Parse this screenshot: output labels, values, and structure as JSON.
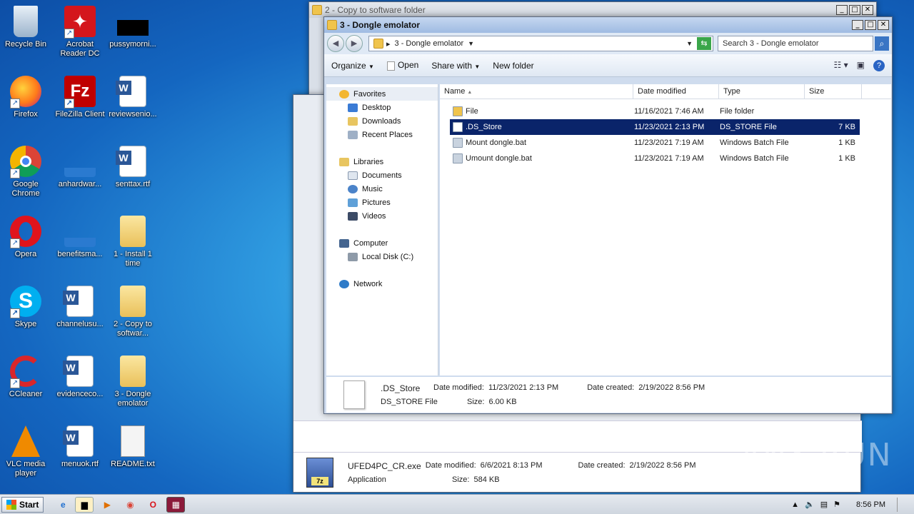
{
  "desktop": {
    "icons": [
      {
        "label": "Recycle Bin"
      },
      {
        "label": "Acrobat Reader DC"
      },
      {
        "label": "pussymorni..."
      },
      {
        "label": "Firefox"
      },
      {
        "label": "FileZilla Client"
      },
      {
        "label": "reviewsenio..."
      },
      {
        "label": "Google Chrome"
      },
      {
        "label": "anhardwar..."
      },
      {
        "label": "senttax.rtf"
      },
      {
        "label": "Opera"
      },
      {
        "label": "benefitsma..."
      },
      {
        "label": "1 - Install 1 time"
      },
      {
        "label": "Skype"
      },
      {
        "label": "channelusu..."
      },
      {
        "label": "2 - Copy to softwar..."
      },
      {
        "label": "CCleaner"
      },
      {
        "label": "evidenceco..."
      },
      {
        "label": "3 - Dongle emolator"
      },
      {
        "label": "VLC media player"
      },
      {
        "label": "menuok.rtf"
      },
      {
        "label": "README.txt"
      }
    ]
  },
  "back_window": {
    "title": "2 - Copy to software folder",
    "details": {
      "name": "UFED4PC_CR.exe",
      "type": "Application",
      "date_modified_label": "Date modified:",
      "date_modified": "6/6/2021 8:13 PM",
      "size_label": "Size:",
      "size": "584 KB",
      "date_created_label": "Date created:",
      "date_created": "2/19/2022 8:56 PM"
    }
  },
  "front_window": {
    "title": "3 - Dongle emolator",
    "breadcrumb": "3 - Dongle emolator",
    "search_placeholder": "Search 3 - Dongle emolator",
    "toolbar": {
      "organize": "Organize",
      "open": "Open",
      "share_with": "Share with",
      "new_folder": "New folder"
    },
    "nav": {
      "favorites": "Favorites",
      "desktop": "Desktop",
      "downloads": "Downloads",
      "recent_places": "Recent Places",
      "libraries": "Libraries",
      "documents": "Documents",
      "music": "Music",
      "pictures": "Pictures",
      "videos": "Videos",
      "computer": "Computer",
      "local_disk": "Local Disk (C:)",
      "network": "Network"
    },
    "columns": {
      "name": "Name",
      "date": "Date modified",
      "type": "Type",
      "size": "Size"
    },
    "files": [
      {
        "name": "File",
        "date": "11/16/2021 7:46 AM",
        "type": "File folder",
        "size": "",
        "icon": "folder",
        "selected": false
      },
      {
        "name": ".DS_Store",
        "date": "11/23/2021 2:13 PM",
        "type": "DS_STORE File",
        "size": "7 KB",
        "icon": "file",
        "selected": true
      },
      {
        "name": "Mount dongle.bat",
        "date": "11/23/2021 7:19 AM",
        "type": "Windows Batch File",
        "size": "1 KB",
        "icon": "bat",
        "selected": false
      },
      {
        "name": "Umount dongle.bat",
        "date": "11/23/2021 7:19 AM",
        "type": "Windows Batch File",
        "size": "1 KB",
        "icon": "bat",
        "selected": false
      }
    ],
    "details": {
      "name": ".DS_Store",
      "type": "DS_STORE File",
      "date_modified_label": "Date modified:",
      "date_modified": "11/23/2021 2:13 PM",
      "size_label": "Size:",
      "size": "6.00 KB",
      "date_created_label": "Date created:",
      "date_created": "2/19/2022 8:56 PM"
    }
  },
  "taskbar": {
    "start": "Start",
    "clock": "8:56 PM"
  },
  "watermark": "ANY RUN"
}
